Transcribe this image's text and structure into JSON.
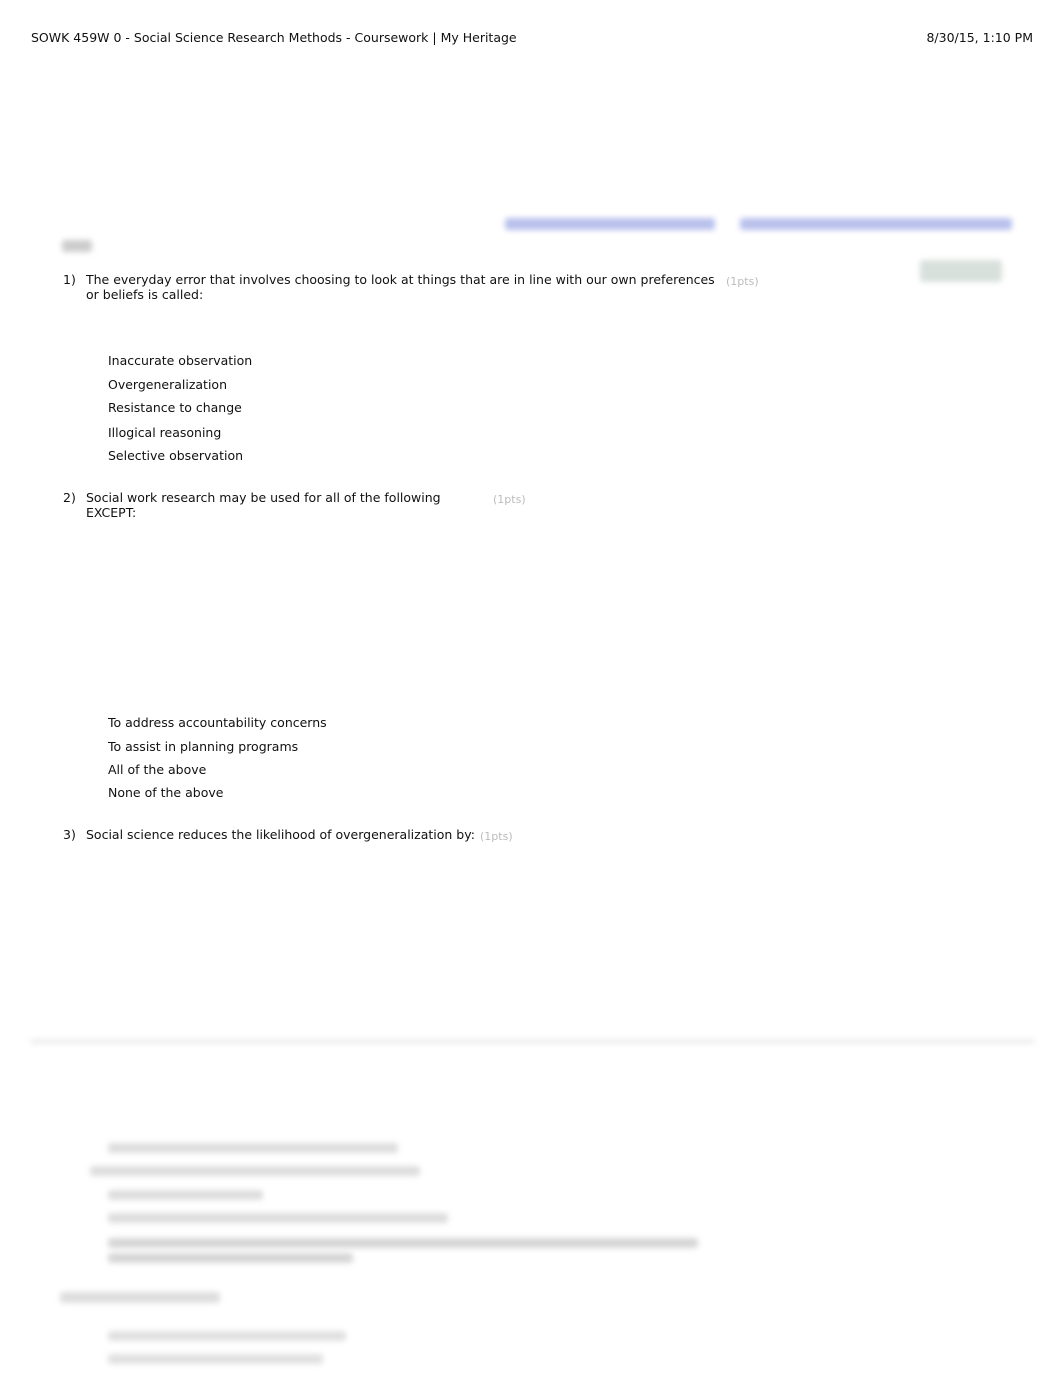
{
  "header": {
    "title": "SOWK 459W 0 - Social Science Research Methods - Coursework | My Heritage",
    "date": "8/30/15, 1:10 PM"
  },
  "questions": [
    {
      "number": "1)",
      "text": "The everyday error that involves choosing to look at things that are in line with our own preferences",
      "text2": "or beliefs is called:",
      "points": "(1pts)",
      "options": [
        "Inaccurate observation",
        "Overgeneralization",
        "Resistance to change",
        "Illogical reasoning",
        "Selective observation"
      ]
    },
    {
      "number": "2)",
      "text": "Social work research may be used for all of the following",
      "text2": "EXCEPT:",
      "points": "(1pts)",
      "options": [
        "To address accountability concerns",
        "To assist in planning programs",
        "All of the above",
        "None of the above"
      ]
    },
    {
      "number": "3)",
      "text": "Social science reduces the likelihood of overgeneralization by:",
      "points": "(1pts)"
    }
  ],
  "colors": {
    "link_blur": "#b8c0ec",
    "points": "#bbbbbb"
  }
}
